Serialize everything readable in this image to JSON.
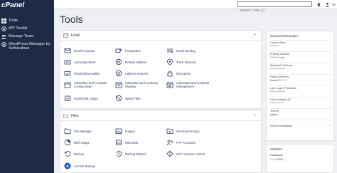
{
  "brand": "cPanel",
  "sidebar": {
    "items": [
      {
        "label": "Tools",
        "icon": "grid-icon"
      },
      {
        "label": "WP Toolkit",
        "icon": "wordpress-icon"
      },
      {
        "label": "Manage Team",
        "icon": "team-icon"
      },
      {
        "label": "WordPress Manager by Softaculous",
        "line1": "WordPress Manager by",
        "line2": "Softaculous",
        "icon": "wordpress-icon"
      }
    ]
  },
  "header": {
    "search_placeholder": "Search Tools (/)"
  },
  "page_title": "Tools",
  "email_panel": {
    "title": "Email",
    "tools": [
      {
        "label": "Email Accounts",
        "icon": "email-accounts-icon"
      },
      {
        "label": "Forwarders",
        "icon": "forwarders-icon"
      },
      {
        "label": "Email Routing",
        "icon": "email-routing-icon"
      },
      {
        "label": "Autoresponders",
        "icon": "autoresponders-icon"
      },
      {
        "label": "Default Address",
        "icon": "default-address-icon"
      },
      {
        "label": "Track Delivery",
        "icon": "track-delivery-icon"
      },
      {
        "label": "Email Deliverability",
        "icon": "email-deliverability-icon"
      },
      {
        "label": "Address Importer",
        "icon": "address-importer-icon"
      },
      {
        "label": "Encryption",
        "icon": "encryption-icon"
      },
      {
        "label_l1": "Calendars and Contacts",
        "label_l2": "Configuration",
        "icon": "calendar-icon"
      },
      {
        "label_l1": "Calendars and Contacts",
        "label_l2": "Sharing",
        "icon": "calendar-sharing-icon"
      },
      {
        "label_l1": "Calendars and Contacts",
        "label_l2": "Management",
        "icon": "calendar-management-icon"
      },
      {
        "label": "Email Disk Usage",
        "icon": "email-disk-usage-icon"
      },
      {
        "label": "Spam Filter",
        "icon": "spam-filter-icon"
      }
    ]
  },
  "files_panel": {
    "title": "Files",
    "tools": [
      {
        "label": "File Manager",
        "icon": "file-manager-icon"
      },
      {
        "label": "Images",
        "icon": "images-icon"
      },
      {
        "label": "Directory Privacy",
        "icon": "directory-privacy-icon"
      },
      {
        "label": "Disk Usage",
        "icon": "disk-usage-icon"
      },
      {
        "label": "Web Disk",
        "icon": "web-disk-icon"
      },
      {
        "label": "FTP Accounts",
        "icon": "ftp-accounts-icon"
      },
      {
        "label": "Backup",
        "icon": "backup-icon"
      },
      {
        "label": "Backup Wizard",
        "icon": "backup-wizard-icon"
      },
      {
        "label": "Git™ Version Control",
        "icon": "git-icon"
      },
      {
        "label": "Acronis Backup",
        "icon": "acronis-icon"
      }
    ]
  },
  "general_info": {
    "title": "General Information",
    "rows": [
      {
        "label": "Current User",
        "value": "********"
      },
      {
        "label": "Primary Domain",
        "value": "********.com"
      },
      {
        "label": "Shared IP Address",
        "value": "***.***.***.***"
      },
      {
        "label": "Home Directory",
        "value": "/home/********"
      },
      {
        "label": "Last Login IP Address",
        "value": "***.***.***.***"
      },
      {
        "label": "User Analytics ID",
        "value": "********-****"
      },
      {
        "label": "Theme",
        "value": "jupiter"
      }
    ],
    "server_info_link": "Server Information"
  },
  "statistics": {
    "title": "Statistics",
    "label": "Databases",
    "value": "1 / 5  (20%)"
  },
  "colors": {
    "sidebar_bg": "#1e2b46",
    "link": "#2b3b66",
    "accent": "#1a56c9"
  }
}
